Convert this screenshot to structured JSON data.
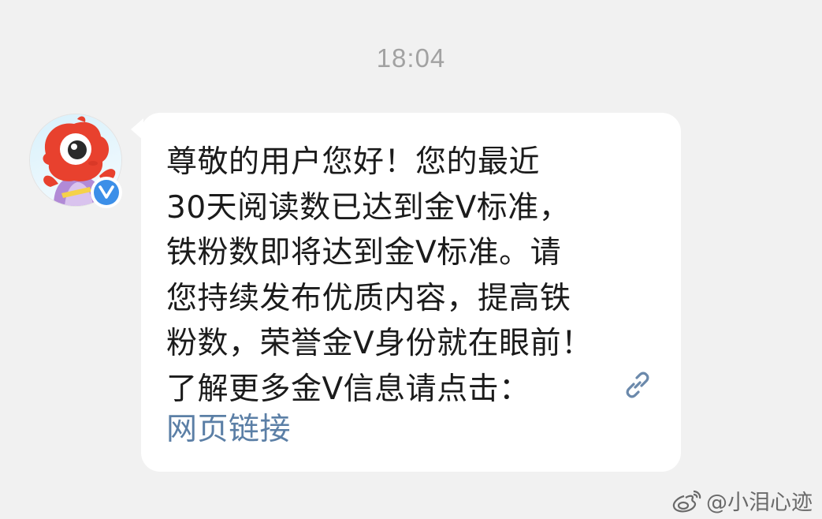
{
  "timestamp": "18:04",
  "sender": {
    "avatar_icon": "weibo-mascot-avatar-icon",
    "verified_badge_icon": "verified-v-icon",
    "verified_badge_text": "V"
  },
  "message": {
    "lines": [
      "尊敬的用户您好！您的最近",
      "30天阅读数已达到金V标准，",
      "铁粉数即将达到金V标准。请",
      "您持续发布优质内容，提高铁",
      "粉数，荣誉金V身份就在眼前！",
      "了解更多金V信息请点击："
    ],
    "link_icon": "link-icon",
    "link_text": "网页链接"
  },
  "watermark": {
    "icon": "weibo-logo-icon",
    "text": "@小泪心迹"
  },
  "colors": {
    "background": "#f1f1f1",
    "bubble": "#ffffff",
    "text": "#1b1b1b",
    "link": "#5b7fa6",
    "timestamp": "#a2a2a2",
    "verified": "#3c8fe8",
    "mascot_red": "#e8412e"
  }
}
